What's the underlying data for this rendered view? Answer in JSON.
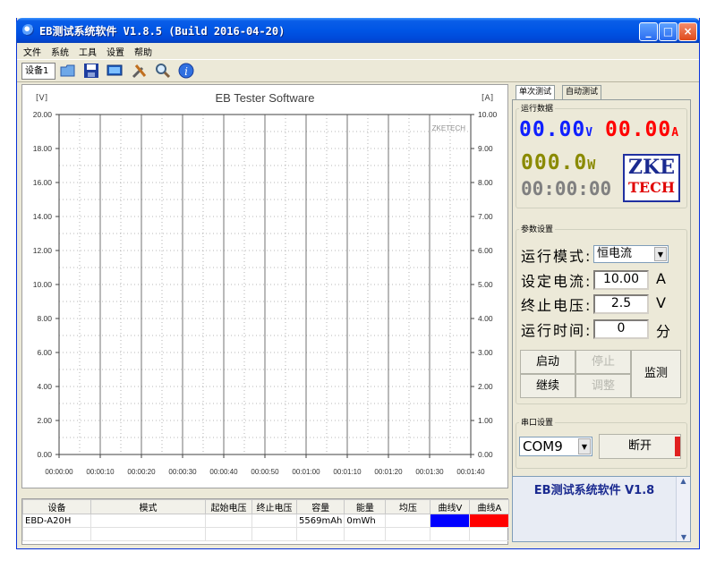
{
  "window": {
    "title": "EB测试系统软件  V1.8.5 (Build 2016-04-20)",
    "controls": {
      "minimize": "_",
      "maximize": "□",
      "close": "×"
    }
  },
  "menu": [
    "文件",
    "系统",
    "工具",
    "设置",
    "帮助"
  ],
  "toolbar": {
    "device_tab": "设备1",
    "icons": [
      "folder-icon",
      "save-icon",
      "monitor-icon",
      "tools-icon",
      "zoom-icon",
      "info-icon"
    ]
  },
  "chart_data": {
    "type": "line",
    "title": "EB Tester Software",
    "watermark": "ZKETECH",
    "ylabel_left": "[V]",
    "ylabel_right": "[A]",
    "y_left_ticks": [
      "0.00",
      "2.00",
      "4.00",
      "6.00",
      "8.00",
      "10.00",
      "12.00",
      "14.00",
      "16.00",
      "18.00",
      "20.00"
    ],
    "y_right_ticks": [
      "0.00",
      "1.00",
      "2.00",
      "3.00",
      "4.00",
      "5.00",
      "6.00",
      "7.00",
      "8.00",
      "9.00",
      "10.00"
    ],
    "x_ticks": [
      "00:00:00",
      "00:00:10",
      "00:00:20",
      "00:00:30",
      "00:00:40",
      "00:00:50",
      "00:01:00",
      "00:01:10",
      "00:01:20",
      "00:01:30",
      "00:01:40"
    ],
    "ylim_left": [
      0,
      20
    ],
    "ylim_right": [
      0,
      10
    ],
    "grid": true,
    "series": []
  },
  "table": {
    "headers": [
      "设备",
      "模式",
      "起始电压",
      "终止电压",
      "容量",
      "能量",
      "均压",
      "曲线V",
      "曲线A"
    ],
    "rows": [
      {
        "device": "EBD-A20H",
        "mode": "",
        "start_v": "",
        "end_v": "",
        "capacity": "5569mAh",
        "energy": "0mWh",
        "avg_v": "",
        "curve_v_color": "#0000ff",
        "curve_a_color": "#ff0000"
      }
    ]
  },
  "tabs": [
    "单次测试",
    "自动测试"
  ],
  "readings": {
    "group_label": "运行数据",
    "voltage": "00.00",
    "voltage_unit": "V",
    "current": "00.00",
    "current_unit": "A",
    "power": "000.0",
    "power_unit": "W",
    "time": "00:00:00",
    "colors": {
      "voltage": "#1020ff",
      "current": "#ff0000",
      "power": "#8a8a00",
      "time": "#808080"
    }
  },
  "logo": {
    "line1": "ZKE",
    "line2": "TECH"
  },
  "params": {
    "group_label": "参数设置",
    "mode_label": "运行模式:",
    "mode_value": "恒电流",
    "current_label": "设定电流:",
    "current_value": "10.00",
    "current_unit": "A",
    "cutoff_label": "终止电压:",
    "cutoff_value": "2.5",
    "cutoff_unit": "V",
    "time_label": "运行时间:",
    "time_value": "0",
    "time_unit": "分"
  },
  "buttons": {
    "start": "启动",
    "stop": "停止",
    "continue": "继续",
    "adjust": "调整",
    "monitor": "监测"
  },
  "serial": {
    "group_label": "串口设置",
    "port": "COM9",
    "connect": "断开"
  },
  "status": {
    "text": "EB测试系统软件 V1.8"
  }
}
